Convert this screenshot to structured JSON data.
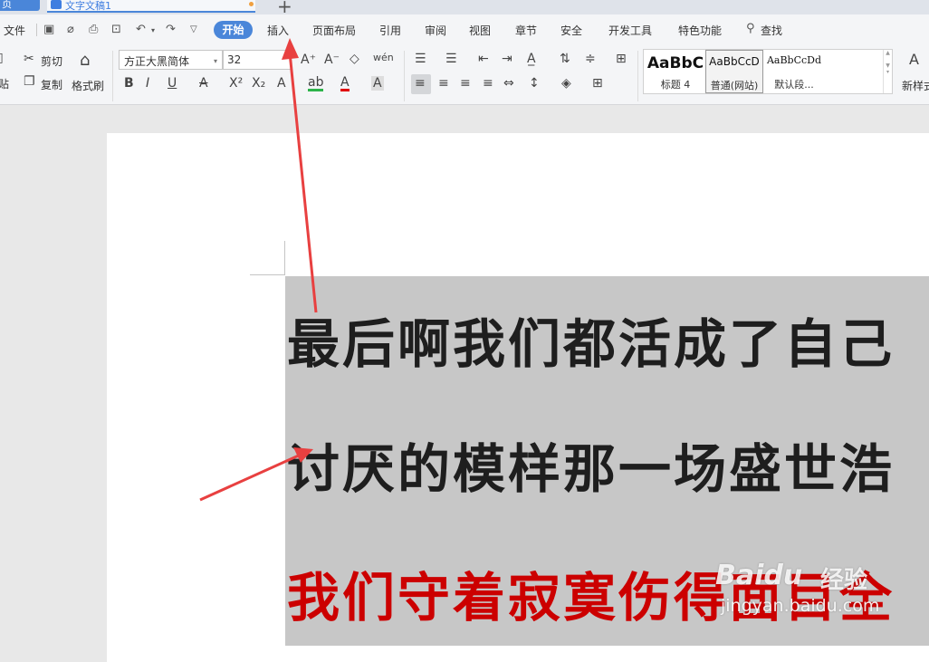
{
  "tabs": {
    "home": "页",
    "doc_title": "文字文稿1",
    "new_tab": "+"
  },
  "menu": {
    "file": "文件",
    "items": [
      "开始",
      "插入",
      "页面布局",
      "引用",
      "审阅",
      "视图",
      "章节",
      "安全",
      "开发工具",
      "特色功能"
    ],
    "active": "开始",
    "search": "查找"
  },
  "ribbon": {
    "cut": "剪切",
    "copy": "复制",
    "paste": "贴",
    "format_painter": "格式刷",
    "font_name": "方正大黑简体",
    "font_size": "32",
    "new_style": "新样式",
    "styles": [
      {
        "preview": "AaBbC",
        "name": "标题 4"
      },
      {
        "preview": "AaBbCcD",
        "name": "普通(网站)"
      },
      {
        "preview": "AaBbCcDd",
        "name": "默认段..."
      }
    ]
  },
  "document": {
    "lines": [
      "最后啊我们都活成了自己",
      "讨厌的模样那一场盛世浩",
      "我们守着寂寞伤得面目全"
    ],
    "colors": {
      "black": "#1e1e1e",
      "red": "#cc0000",
      "selection": "#c7c7c7",
      "accent": "#4a86d9",
      "arrow": "#e84040"
    }
  },
  "watermark": {
    "logo": "Baidu",
    "cn": "经验",
    "url": "jingyan.baidu.com"
  }
}
